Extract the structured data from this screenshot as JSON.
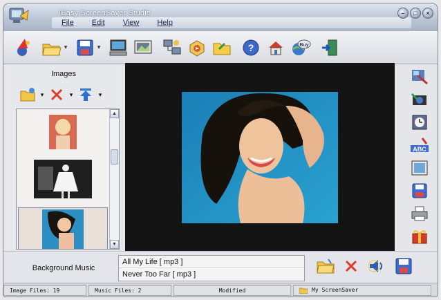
{
  "window": {
    "title": "IEasy ScreenSaver Studio"
  },
  "menu": [
    "File",
    "Edit",
    "View",
    "Help"
  ],
  "toolbar": {
    "buttons": [
      {
        "name": "wizard-icon"
      },
      {
        "name": "open-folder-icon"
      },
      {
        "name": "save-disk-icon"
      },
      {
        "name": "computer-preview-icon"
      },
      {
        "name": "screen-settings-icon"
      },
      {
        "name": "network-icon"
      },
      {
        "name": "package-icon"
      },
      {
        "name": "folder-icon"
      },
      {
        "name": "help-icon"
      },
      {
        "name": "home-icon"
      },
      {
        "name": "buy-icon"
      },
      {
        "name": "exit-icon"
      }
    ]
  },
  "images_panel": {
    "label": "Images",
    "image_count": 19
  },
  "right_tools": [
    "image-effects-icon",
    "camera-icon",
    "clock-icon",
    "text-abc-icon",
    "background-icon",
    "disk-icon",
    "printer-icon",
    "gift-icon"
  ],
  "music": {
    "label": "Background Music",
    "tracks": [
      "All My Life [ mp3 ]",
      "Never Too Far [ mp3 ]"
    ]
  },
  "status": {
    "image_files": "Image Files: 19",
    "music_files": "Music Files: 2",
    "modified": "Modified",
    "project": "My ScreenSaver"
  },
  "colors": {
    "preview_bg": "#141414",
    "titlebar": "#b9c3d3",
    "accent": "#2d5fb5"
  }
}
